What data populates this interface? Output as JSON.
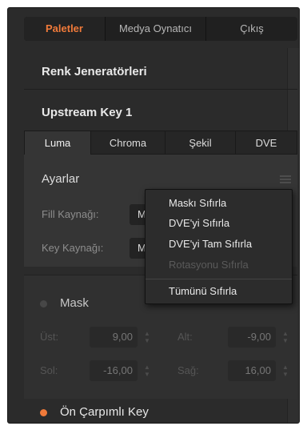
{
  "tabs": [
    "Paletler",
    "Medya Oynatıcı",
    "Çıkış"
  ],
  "sections": {
    "color_generators": "Renk Jeneratörleri",
    "upstream_key": "Upstream Key 1"
  },
  "key_tabs": [
    "Luma",
    "Chroma",
    "Şekil",
    "DVE"
  ],
  "settings": {
    "title": "Ayarlar",
    "fill_source_label": "Fill Kaynağı:",
    "fill_source_value": "M",
    "key_source_label": "Key Kaynağı:",
    "key_source_value": "M"
  },
  "context_menu": {
    "items": [
      "Maskı Sıfırla",
      "DVE'yi Sıfırla",
      "DVE'yi Tam Sıfırla",
      "Rotasyonu Sıfırla",
      "Tümünü Sıfırla"
    ]
  },
  "mask": {
    "label": "Mask",
    "top_label": "Üst:",
    "top_value": "9,00",
    "bottom_label": "Alt:",
    "bottom_value": "-9,00",
    "left_label": "Sol:",
    "left_value": "-16,00",
    "right_label": "Sağ:",
    "right_value": "16,00"
  },
  "premultiplied": {
    "label": "Ön Çarpımlı Key"
  },
  "colors": {
    "accent": "#f07a3a",
    "panel": "#353535",
    "background": "#2b2b2b"
  }
}
